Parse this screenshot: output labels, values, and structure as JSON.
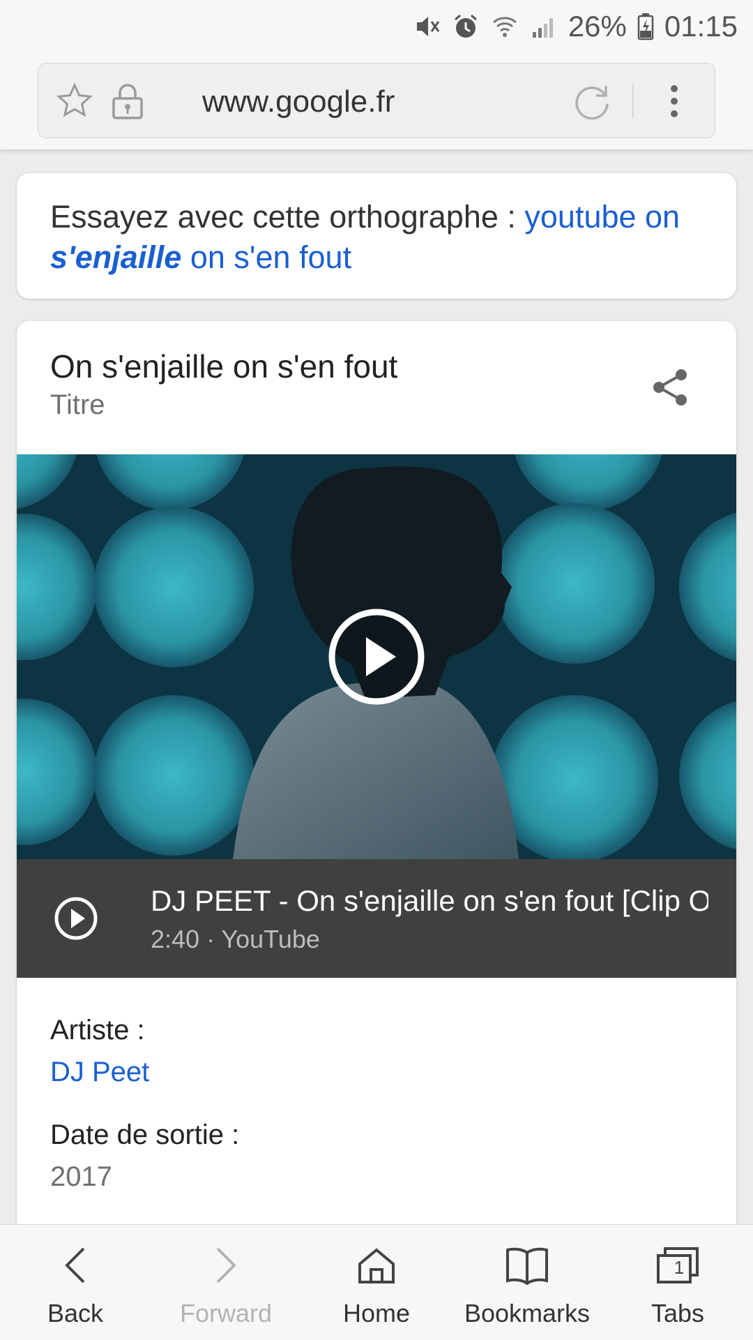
{
  "status_bar": {
    "battery": "26%",
    "time": "01:15",
    "icons": [
      "mute-icon",
      "alarm-icon",
      "wifi-icon",
      "signal-icon",
      "battery-charging-icon"
    ]
  },
  "address_bar": {
    "url": "www.google.fr",
    "icons": [
      "star-icon",
      "lock-icon",
      "reload-icon",
      "more-vert-icon"
    ]
  },
  "spelling": {
    "prefix": "Essayez avec cette orthographe : ",
    "link_before": "youtube on ",
    "link_bold": "s'enjaille",
    "link_after": " on s'en fout"
  },
  "song_card": {
    "title": "On s'enjaille on s'en fout",
    "subtitle": "Titre",
    "video": {
      "title": "DJ PEET - On s'enjaille on s'en fout [Clip O..",
      "meta": "2:40 · YouTube"
    },
    "artist_label": "Artiste :",
    "artist_value": "DJ Peet",
    "release_label": "Date de sortie :",
    "release_value": "2017"
  },
  "bottom_nav": {
    "back": "Back",
    "forward": "Forward",
    "home": "Home",
    "bookmarks": "Bookmarks",
    "tabs": "Tabs",
    "tabs_count": "1"
  },
  "colors": {
    "link": "#1a5fd1",
    "video_bar": "#404040",
    "thumb_teal": "#2fa4b3"
  }
}
